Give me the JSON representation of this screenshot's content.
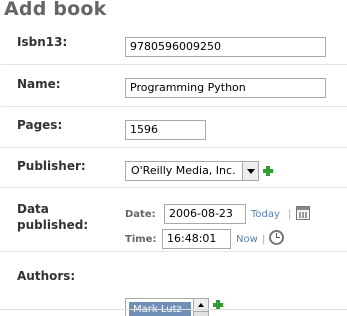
{
  "page": {
    "title": "Add book"
  },
  "fields": {
    "isbn13": {
      "label": "Isbn13:",
      "value": "9780596009250"
    },
    "name": {
      "label": "Name:",
      "value": "Programming Python"
    },
    "pages": {
      "label": "Pages:",
      "value": "1596"
    },
    "publisher": {
      "label": "Publisher:",
      "selected": "O'Reilly Media, Inc."
    },
    "date_published": {
      "label": "Data published:",
      "date_label": "Date:",
      "date_value": "2006-08-23",
      "today_link": "Today",
      "time_label": "Time:",
      "time_value": "16:48:01",
      "now_link": "Now",
      "separator": "|"
    },
    "authors": {
      "label": "Authors:",
      "options": [
        "Mark Lutz"
      ]
    }
  },
  "icons": {
    "add": "add-icon",
    "calendar": "calendar-icon",
    "clock": "clock-icon",
    "dropdown": "chevron-down-icon",
    "scroll_up": "scroll-up-icon"
  },
  "colors": {
    "add_icon": "#2e9e2e",
    "link": "#5b80b2",
    "selected_option": "#6f8fb7"
  }
}
